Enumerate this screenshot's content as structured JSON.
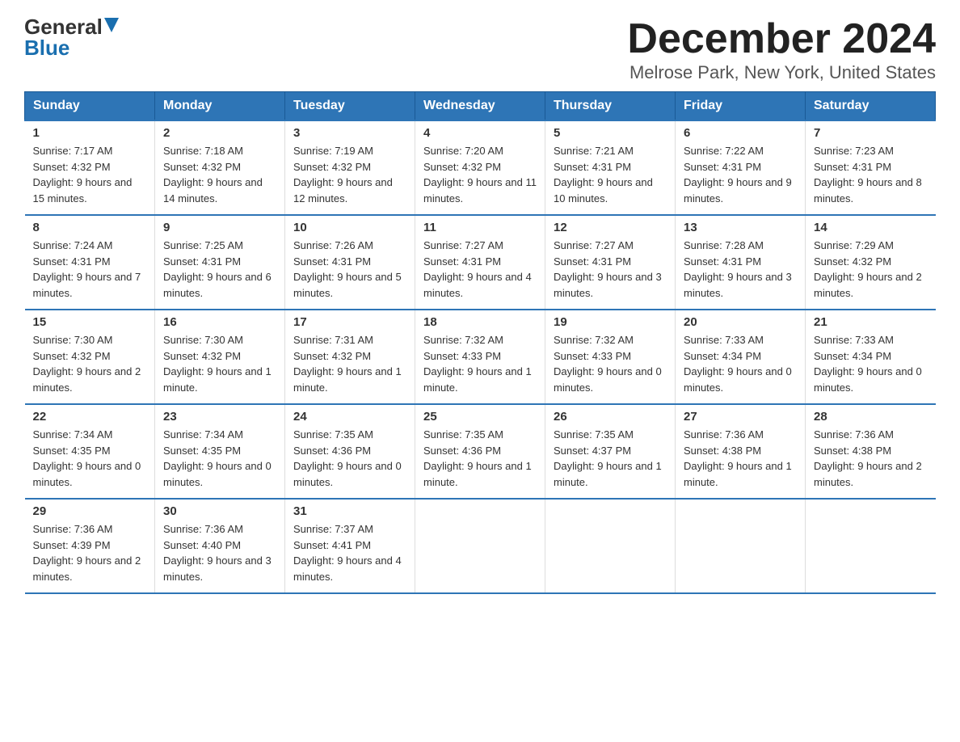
{
  "header": {
    "logo_general": "General",
    "logo_blue": "Blue",
    "month_title": "December 2024",
    "location": "Melrose Park, New York, United States"
  },
  "days_of_week": [
    "Sunday",
    "Monday",
    "Tuesday",
    "Wednesday",
    "Thursday",
    "Friday",
    "Saturday"
  ],
  "weeks": [
    [
      {
        "day": "1",
        "sunrise": "7:17 AM",
        "sunset": "4:32 PM",
        "daylight": "9 hours and 15 minutes."
      },
      {
        "day": "2",
        "sunrise": "7:18 AM",
        "sunset": "4:32 PM",
        "daylight": "9 hours and 14 minutes."
      },
      {
        "day": "3",
        "sunrise": "7:19 AM",
        "sunset": "4:32 PM",
        "daylight": "9 hours and 12 minutes."
      },
      {
        "day": "4",
        "sunrise": "7:20 AM",
        "sunset": "4:32 PM",
        "daylight": "9 hours and 11 minutes."
      },
      {
        "day": "5",
        "sunrise": "7:21 AM",
        "sunset": "4:31 PM",
        "daylight": "9 hours and 10 minutes."
      },
      {
        "day": "6",
        "sunrise": "7:22 AM",
        "sunset": "4:31 PM",
        "daylight": "9 hours and 9 minutes."
      },
      {
        "day": "7",
        "sunrise": "7:23 AM",
        "sunset": "4:31 PM",
        "daylight": "9 hours and 8 minutes."
      }
    ],
    [
      {
        "day": "8",
        "sunrise": "7:24 AM",
        "sunset": "4:31 PM",
        "daylight": "9 hours and 7 minutes."
      },
      {
        "day": "9",
        "sunrise": "7:25 AM",
        "sunset": "4:31 PM",
        "daylight": "9 hours and 6 minutes."
      },
      {
        "day": "10",
        "sunrise": "7:26 AM",
        "sunset": "4:31 PM",
        "daylight": "9 hours and 5 minutes."
      },
      {
        "day": "11",
        "sunrise": "7:27 AM",
        "sunset": "4:31 PM",
        "daylight": "9 hours and 4 minutes."
      },
      {
        "day": "12",
        "sunrise": "7:27 AM",
        "sunset": "4:31 PM",
        "daylight": "9 hours and 3 minutes."
      },
      {
        "day": "13",
        "sunrise": "7:28 AM",
        "sunset": "4:31 PM",
        "daylight": "9 hours and 3 minutes."
      },
      {
        "day": "14",
        "sunrise": "7:29 AM",
        "sunset": "4:32 PM",
        "daylight": "9 hours and 2 minutes."
      }
    ],
    [
      {
        "day": "15",
        "sunrise": "7:30 AM",
        "sunset": "4:32 PM",
        "daylight": "9 hours and 2 minutes."
      },
      {
        "day": "16",
        "sunrise": "7:30 AM",
        "sunset": "4:32 PM",
        "daylight": "9 hours and 1 minute."
      },
      {
        "day": "17",
        "sunrise": "7:31 AM",
        "sunset": "4:32 PM",
        "daylight": "9 hours and 1 minute."
      },
      {
        "day": "18",
        "sunrise": "7:32 AM",
        "sunset": "4:33 PM",
        "daylight": "9 hours and 1 minute."
      },
      {
        "day": "19",
        "sunrise": "7:32 AM",
        "sunset": "4:33 PM",
        "daylight": "9 hours and 0 minutes."
      },
      {
        "day": "20",
        "sunrise": "7:33 AM",
        "sunset": "4:34 PM",
        "daylight": "9 hours and 0 minutes."
      },
      {
        "day": "21",
        "sunrise": "7:33 AM",
        "sunset": "4:34 PM",
        "daylight": "9 hours and 0 minutes."
      }
    ],
    [
      {
        "day": "22",
        "sunrise": "7:34 AM",
        "sunset": "4:35 PM",
        "daylight": "9 hours and 0 minutes."
      },
      {
        "day": "23",
        "sunrise": "7:34 AM",
        "sunset": "4:35 PM",
        "daylight": "9 hours and 0 minutes."
      },
      {
        "day": "24",
        "sunrise": "7:35 AM",
        "sunset": "4:36 PM",
        "daylight": "9 hours and 0 minutes."
      },
      {
        "day": "25",
        "sunrise": "7:35 AM",
        "sunset": "4:36 PM",
        "daylight": "9 hours and 1 minute."
      },
      {
        "day": "26",
        "sunrise": "7:35 AM",
        "sunset": "4:37 PM",
        "daylight": "9 hours and 1 minute."
      },
      {
        "day": "27",
        "sunrise": "7:36 AM",
        "sunset": "4:38 PM",
        "daylight": "9 hours and 1 minute."
      },
      {
        "day": "28",
        "sunrise": "7:36 AM",
        "sunset": "4:38 PM",
        "daylight": "9 hours and 2 minutes."
      }
    ],
    [
      {
        "day": "29",
        "sunrise": "7:36 AM",
        "sunset": "4:39 PM",
        "daylight": "9 hours and 2 minutes."
      },
      {
        "day": "30",
        "sunrise": "7:36 AM",
        "sunset": "4:40 PM",
        "daylight": "9 hours and 3 minutes."
      },
      {
        "day": "31",
        "sunrise": "7:37 AM",
        "sunset": "4:41 PM",
        "daylight": "9 hours and 4 minutes."
      },
      null,
      null,
      null,
      null
    ]
  ]
}
